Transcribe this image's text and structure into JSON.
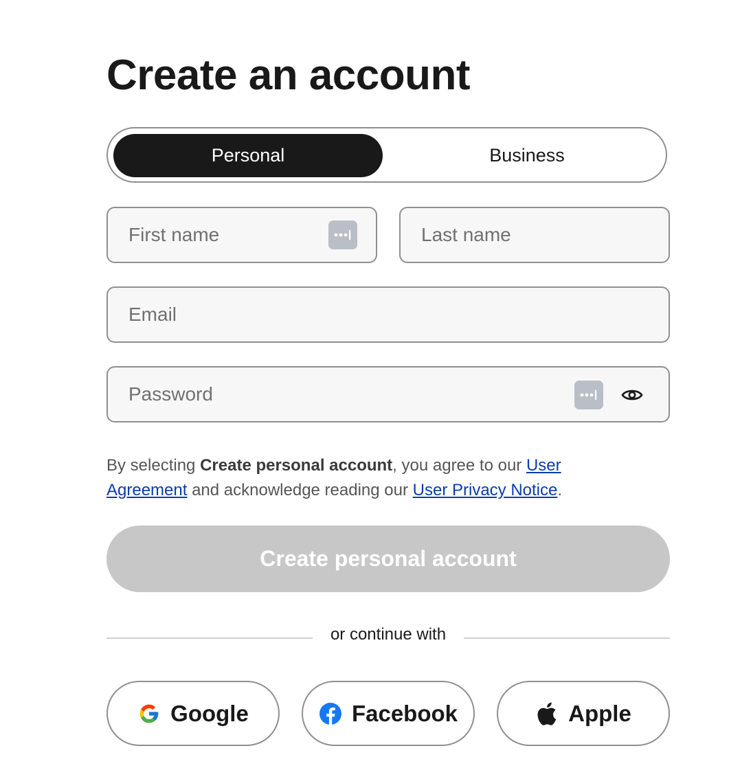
{
  "page": {
    "title": "Create an account"
  },
  "account_type": {
    "options": [
      {
        "label": "Personal",
        "selected": true
      },
      {
        "label": "Business",
        "selected": false
      }
    ]
  },
  "form": {
    "first_name": {
      "placeholder": "First name",
      "value": ""
    },
    "last_name": {
      "placeholder": "Last name",
      "value": ""
    },
    "email": {
      "placeholder": "Email",
      "value": ""
    },
    "password": {
      "placeholder": "Password",
      "value": ""
    }
  },
  "icons": {
    "password_manager": "password-manager-icon",
    "show_password": "eye-icon",
    "google": "google-icon",
    "facebook": "facebook-icon",
    "apple": "apple-icon"
  },
  "legal": {
    "prefix": "By selecting ",
    "bold": "Create personal account",
    "middle": ", you agree to our ",
    "link1": "User Agreement",
    "middle2": " and acknowledge reading our ",
    "link2": "User Privacy Notice",
    "suffix": "."
  },
  "submit": {
    "label": "Create personal account",
    "enabled": false
  },
  "divider": {
    "label": "or continue with"
  },
  "social": [
    {
      "label": "Google"
    },
    {
      "label": "Facebook"
    },
    {
      "label": "Apple"
    }
  ],
  "colors": {
    "primary_dark": "#191919",
    "field_bg": "#f7f7f7",
    "border": "#8f8f8f",
    "link": "#0a3da8",
    "disabled_button": "#c7c7c7",
    "facebook_blue": "#1877f2"
  }
}
